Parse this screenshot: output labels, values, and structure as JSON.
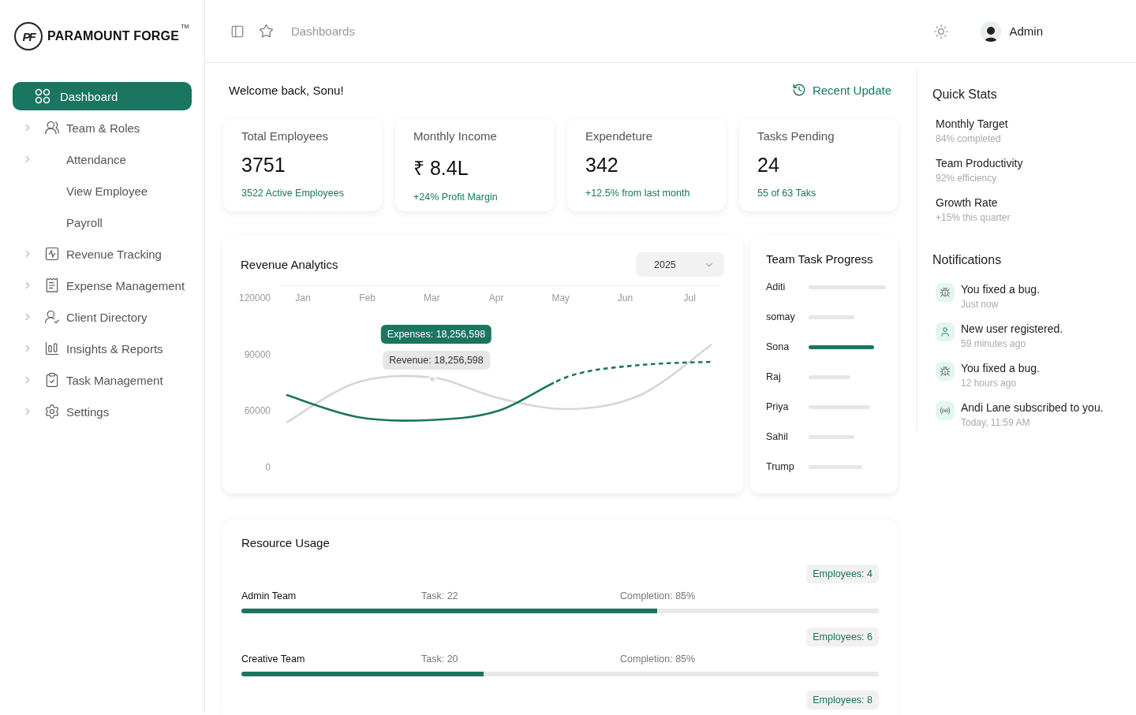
{
  "logo": {
    "monogram": "PF",
    "name": "PARAMOUNT FORGE",
    "mark": "TM"
  },
  "sidebar": {
    "items": [
      {
        "label": "Dashboard",
        "selected": true,
        "expandable": false
      },
      {
        "label": "Team & Roles",
        "selected": false,
        "expandable": true
      },
      {
        "label": "Attendance",
        "selected": false,
        "expandable": true
      },
      {
        "label": "View Employee",
        "selected": false,
        "expandable": false
      },
      {
        "label": "Payroll",
        "selected": false,
        "expandable": false
      },
      {
        "label": "Revenue Tracking",
        "selected": false,
        "expandable": true
      },
      {
        "label": "Expense Management",
        "selected": false,
        "expandable": true
      },
      {
        "label": "Client Directory",
        "selected": false,
        "expandable": true
      },
      {
        "label": "Insights & Reports",
        "selected": false,
        "expandable": true
      },
      {
        "label": "Task Management",
        "selected": false,
        "expandable": true
      },
      {
        "label": "Settings",
        "selected": false,
        "expandable": true
      }
    ]
  },
  "header": {
    "breadcrumb": "Dashboards",
    "user": "Admin"
  },
  "welcome": "Welcome back, Sonu!",
  "recent_update": "Recent Update",
  "stat_cards": [
    {
      "title": "Total Employees",
      "value": "3751",
      "note": "3522 Active Employees"
    },
    {
      "title": "Monthly Income",
      "value": "₹ 8.4L",
      "note": "+24% Profit Margin"
    },
    {
      "title": "Expendeture",
      "value": "342",
      "note": "+12.5% from last month"
    },
    {
      "title": "Tasks Pending",
      "value": "24",
      "note": "55 of 63 Taks"
    }
  ],
  "revenue_analytics": {
    "title": "Revenue Analytics",
    "year": "2025",
    "y_labels": [
      "120000",
      "90000",
      "60000",
      "0"
    ],
    "x_labels": [
      "Jan",
      "Feb",
      "Mar",
      "Apr",
      "May",
      "Jun",
      "Jul"
    ],
    "tooltips": [
      {
        "kind": "expenses",
        "text": "Expenses: 18,256,598"
      },
      {
        "kind": "revenue",
        "text": "Revenue: 18,256,598"
      }
    ]
  },
  "team_task_progress": {
    "title": "Team Task Progress",
    "members": [
      {
        "name": "Aditi",
        "selected": false
      },
      {
        "name": "somay",
        "selected": false
      },
      {
        "name": "Sona",
        "selected": true
      },
      {
        "name": "Raj",
        "selected": false
      },
      {
        "name": "Priya",
        "selected": false
      },
      {
        "name": "Sahil",
        "selected": false
      },
      {
        "name": "Trump",
        "selected": false
      }
    ]
  },
  "resource_usage": {
    "title": "Resource Usage",
    "teams": [
      {
        "employees": "Employees: 4",
        "name": "Admin Team",
        "task": "Task: 22",
        "completion": "Completion: 85%",
        "level": 0.652
      },
      {
        "employees": "Employees: 6",
        "name": "Creative Team",
        "task": "Task: 20",
        "completion": "Completion: 85%",
        "level": 0.38
      },
      {
        "employees": "Employees: 8"
      }
    ]
  },
  "quick_stats": {
    "title": "Quick Stats",
    "items": [
      {
        "label": "Monthly Target",
        "detail": "84% completed"
      },
      {
        "label": "Team Productivity",
        "detail": "92% efficiency"
      },
      {
        "label": "Growth Rate",
        "detail": "+15% this quarter"
      }
    ]
  },
  "notifications": {
    "title": "Notifications",
    "items": [
      {
        "kind": "bug",
        "text": "You fixed a bug.",
        "time": "Just now"
      },
      {
        "kind": "user",
        "text": "New user registered.",
        "time": "59 minutes ago"
      },
      {
        "kind": "bug",
        "text": "You fixed a bug.",
        "time": "12 hours ago"
      },
      {
        "kind": "broadcast",
        "text": "Andi Lane subscribed to you.",
        "time": "Today, 11:59 AM"
      }
    ]
  }
}
